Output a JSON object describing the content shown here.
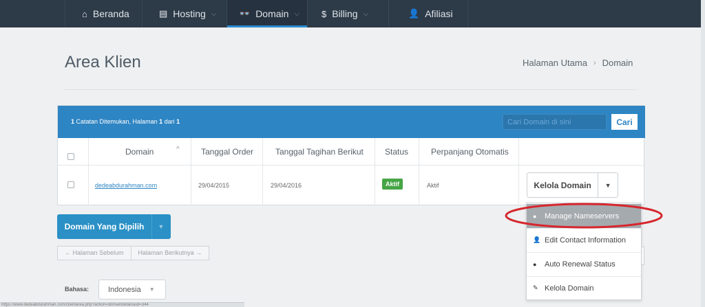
{
  "nav": {
    "items": [
      {
        "label": "Beranda",
        "icon": "home-icon",
        "glyph": "⌂",
        "dropdown": false
      },
      {
        "label": "Hosting",
        "icon": "server-icon",
        "glyph": "▤",
        "dropdown": true
      },
      {
        "label": "Domain",
        "icon": "binoculars-icon",
        "glyph": "👓",
        "dropdown": true,
        "active": true
      },
      {
        "label": "Billing",
        "icon": "dollar-icon",
        "glyph": "$",
        "dropdown": true
      },
      {
        "label": "Afiliasi",
        "icon": "user-icon",
        "glyph": "👤",
        "dropdown": false
      }
    ],
    "chevron": "⌵"
  },
  "header": {
    "title": "Area Klien",
    "breadcrumb": [
      "Halaman Utama",
      "Domain"
    ],
    "breadcrumb_sep": "›"
  },
  "panel": {
    "records_count": "1",
    "records_text_a": " Catatan Ditemukan, Halaman ",
    "records_page": "1",
    "records_text_b": " dari ",
    "records_total": "1",
    "search_placeholder": "Cari Domain di sini",
    "search_button": "Cari"
  },
  "table": {
    "headers": [
      "Domain",
      "Tanggal Order",
      "Tanggal Tagihan Berikut",
      "Status",
      "Perpanjang Otomatis"
    ],
    "sort_glyph": "^",
    "rows": [
      {
        "domain": "dedeabdurahman.com",
        "order_date": "29/04/2015",
        "next_due": "29/04/2016",
        "status": "Aktif",
        "auto_renew": "Aktif",
        "action": "Kelola Domain"
      }
    ]
  },
  "bulk": {
    "label": "Domain Yang Dipilih"
  },
  "pager": {
    "prev": "← Halaman Sebelum",
    "next": "Halaman Berikutnya →"
  },
  "language": {
    "label": "Bahasa:",
    "selected": "Indonesia"
  },
  "dropdown": {
    "items": [
      {
        "label": "Manage Nameservers",
        "icon": "globe-icon",
        "glyph": "●"
      },
      {
        "label": "Edit Contact Information",
        "icon": "user-icon",
        "glyph": "👤"
      },
      {
        "label": "Auto Renewal Status",
        "icon": "globe-icon",
        "glyph": "●"
      },
      {
        "label": "Kelola Domain",
        "icon": "pencil-icon",
        "glyph": "✎"
      }
    ]
  },
  "status_bar": {
    "url": "https://www.dedeabdurahman.com/clientarea.php?action=domaindetails&id=344"
  },
  "colors": {
    "nav_bg": "#2d3a48",
    "accent": "#2e85c3",
    "success": "#46a546",
    "highlight": "#a5aaae",
    "annotation": "#d6262d"
  },
  "glyphs": {
    "caret": "▼"
  }
}
